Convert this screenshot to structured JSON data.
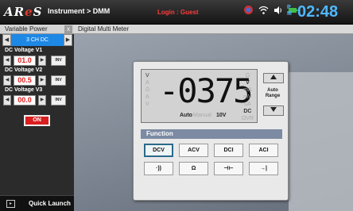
{
  "topbar": {
    "logo_a": "AR",
    "logo_b": "e",
    "logo_c": "S",
    "breadcrumb": "Instrument > DMM",
    "login_text": "Login  :  Guest",
    "ampm_top": "P",
    "ampm_bottom": "M",
    "clock": "02:48"
  },
  "left_panel": {
    "tab_title": "Variable Power",
    "close_glyph": "x",
    "channel": {
      "prev_glyph": "◀",
      "label": "3 CH DC",
      "next_glyph": "▶"
    },
    "voltages": [
      {
        "label": "DC Voltage V1",
        "value": "01.0",
        "inv": "INV"
      },
      {
        "label": "DC Voltage V2",
        "value": "00.5",
        "inv": "INV"
      },
      {
        "label": "DC Voltage V3",
        "value": "00.0",
        "inv": "INV"
      }
    ],
    "arrow_down": "◀",
    "arrow_up": "▶",
    "on_label": "ON",
    "quick_launch": "Quick Launch"
  },
  "main": {
    "tab_title": "Digital Multi Meter"
  },
  "dmm": {
    "reading": "-0375",
    "left_indicators": {
      "v": "V",
      "a1": "A",
      "omega": "Ω",
      "a2": "A",
      "v2": "V"
    },
    "right_indicators": {
      "omega": "Ω",
      "v": "V",
      "ma": "mA",
      "mv": "mV",
      "ua": "uA",
      "dc": "DC",
      "ovr": "OVR"
    },
    "mode_auto": "Auto",
    "mode_manual": "Manual",
    "range_value": "10V",
    "auto_range_label": "Auto Range",
    "function_title": "Function",
    "functions_row1": [
      "DCV",
      "ACV",
      "DCI",
      "ACI"
    ],
    "functions_row2": [
      "·))",
      "Ω",
      "⊣⊢",
      "→|"
    ],
    "active_function": "DCV"
  },
  "colors": {
    "accent": "#1e88e5",
    "voltage_text": "#e02020",
    "on_button": "#d91f1f",
    "clock": "#4fb8ff",
    "login": "#ff3b3b"
  }
}
